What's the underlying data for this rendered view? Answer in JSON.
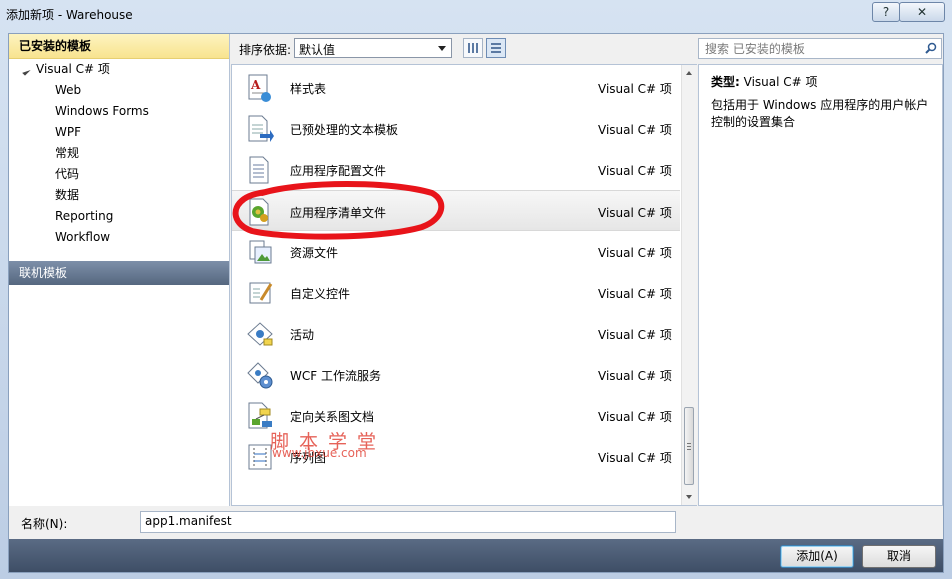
{
  "window": {
    "title": "添加新项 - Warehouse",
    "help_label": "?",
    "close_label": "✕"
  },
  "left": {
    "installed_header": "已安装的模板",
    "root": "Visual C# 项",
    "items": [
      "Web",
      "Windows Forms",
      "WPF",
      "常规",
      "代码",
      "数据",
      "Reporting",
      "Workflow"
    ],
    "online_header": "联机模板"
  },
  "toolbar": {
    "sort_label": "排序依据:",
    "sort_value": "默认值"
  },
  "search": {
    "placeholder": "搜索 已安装的模板"
  },
  "templates": [
    {
      "name": "样式表",
      "type": "Visual C# 项",
      "icon": "stylesheet-icon"
    },
    {
      "name": "已预处理的文本模板",
      "type": "Visual C# 项",
      "icon": "text-template-icon"
    },
    {
      "name": "应用程序配置文件",
      "type": "Visual C# 项",
      "icon": "config-file-icon"
    },
    {
      "name": "应用程序清单文件",
      "type": "Visual C# 项",
      "icon": "manifest-file-icon",
      "selected": true
    },
    {
      "name": "资源文件",
      "type": "Visual C# 项",
      "icon": "resource-file-icon"
    },
    {
      "name": "自定义控件",
      "type": "Visual C# 项",
      "icon": "custom-control-icon"
    },
    {
      "name": "活动",
      "type": "Visual C# 项",
      "icon": "activity-icon"
    },
    {
      "name": "WCF 工作流服务",
      "type": "Visual C# 项",
      "icon": "wcf-workflow-icon"
    },
    {
      "name": "定向关系图文档",
      "type": "Visual C# 项",
      "icon": "dgml-icon"
    },
    {
      "name": "序列图",
      "type": "Visual C# 项",
      "icon": "sequence-diagram-icon"
    }
  ],
  "watermark": {
    "line1": "脚本学堂",
    "line2": "www.jbxue.com"
  },
  "description": {
    "type_label": "类型:",
    "type_value": "Visual C# 项",
    "text": "包括用于 Windows 应用程序的用户帐户控制的设置集合"
  },
  "name_field": {
    "label": "名称(N):",
    "value": "app1.manifest"
  },
  "buttons": {
    "add": "添加(A)",
    "cancel": "取消"
  },
  "colors": {
    "highlight_circle": "#e8141a",
    "selected_header": "#f8e38f",
    "footer": "#4a5a72"
  }
}
